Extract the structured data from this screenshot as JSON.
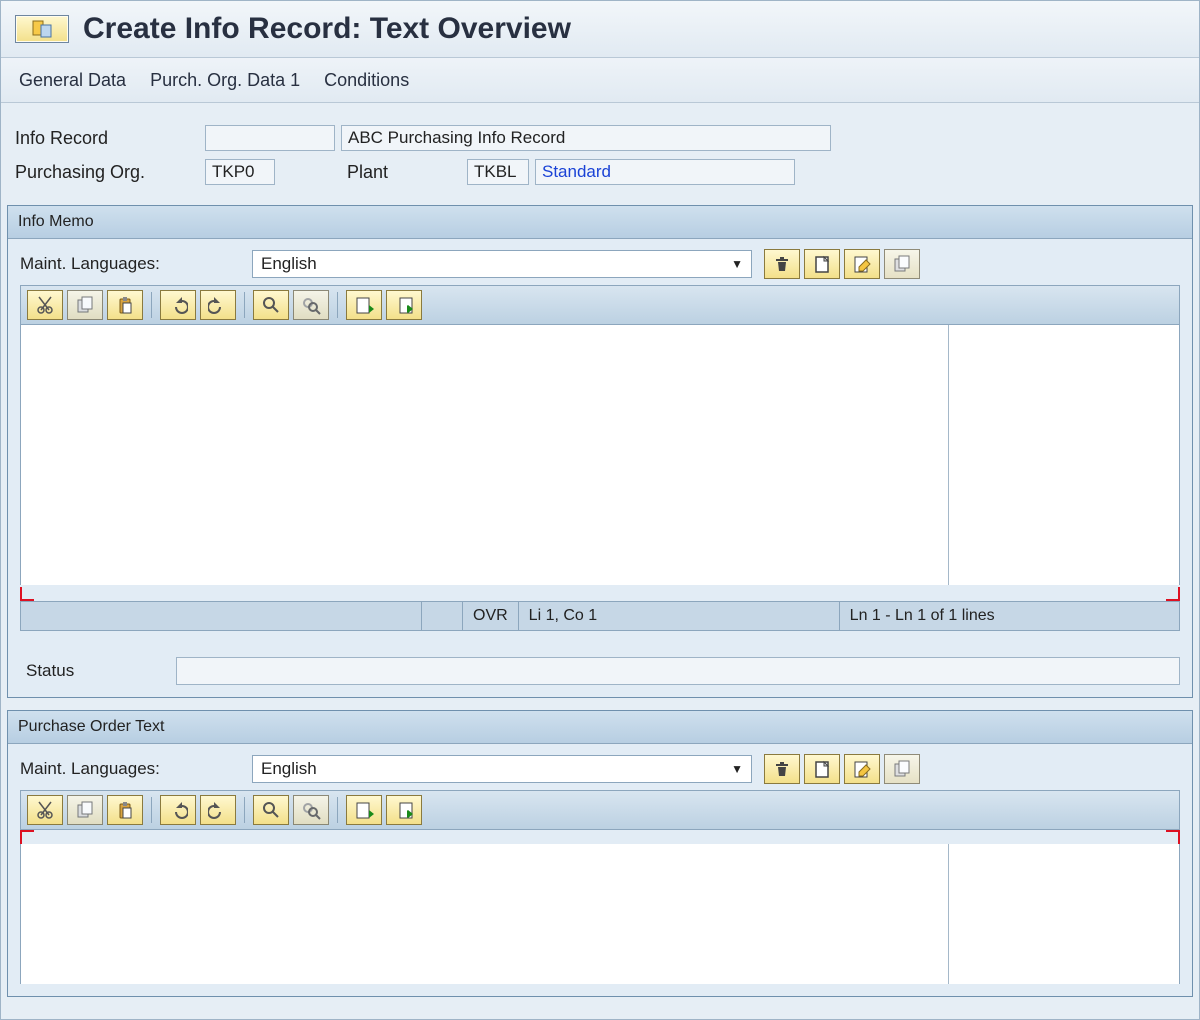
{
  "title": "Create Info Record: Text Overview",
  "menubar": [
    "General Data",
    "Purch. Org. Data 1",
    "Conditions"
  ],
  "form": {
    "info_record_label": "Info Record",
    "info_record_value": "",
    "info_record_desc": "ABC Purchasing Info Record",
    "purch_org_label": "Purchasing Org.",
    "purch_org_value": "TKP0",
    "plant_label": "Plant",
    "plant_value": "TKBL",
    "plant_desc": "Standard"
  },
  "panels": {
    "memo": {
      "title": "Info Memo",
      "lang_label": "Maint. Languages:",
      "lang_value": "English",
      "statusbar": {
        "ovr": "OVR",
        "pos": "Li 1, Co 1",
        "range": "Ln 1 - Ln 1 of 1 lines"
      },
      "status_label": "Status",
      "status_value": ""
    },
    "po": {
      "title": "Purchase Order Text",
      "lang_label": "Maint. Languages:",
      "lang_value": "English"
    }
  },
  "icons": {
    "delete": "delete-icon",
    "new": "new-icon",
    "edit": "edit-icon",
    "copy": "copy-icon",
    "cut": "cut-icon",
    "copy2": "copy2-icon",
    "paste": "paste-icon",
    "undo": "undo-icon",
    "redo": "redo-icon",
    "find": "find-icon",
    "findnext": "findnext-icon",
    "import": "import-icon",
    "export": "export-icon"
  }
}
